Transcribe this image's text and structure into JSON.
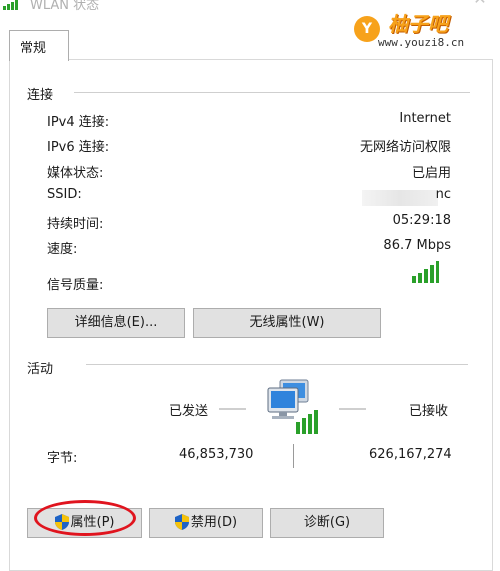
{
  "window": {
    "title": "WLAN 状态"
  },
  "watermark": {
    "logo_letter": "Y",
    "title": "柚子吧",
    "url": "www.youzi8.cn"
  },
  "tabs": [
    {
      "label": "常规"
    }
  ],
  "connection": {
    "title": "连接",
    "rows": [
      {
        "label": "IPv4 连接:",
        "value": "Internet"
      },
      {
        "label": "IPv6 连接:",
        "value": "无网络访问权限"
      },
      {
        "label": "媒体状态:",
        "value": "已启用"
      },
      {
        "label": "SSID:",
        "value": "nc"
      },
      {
        "label": "持续时间:",
        "value": "05:29:18"
      },
      {
        "label": "速度:",
        "value": "86.7 Mbps"
      },
      {
        "label": "信号质量:",
        "value": ""
      }
    ],
    "signal_bars": 5,
    "buttons": {
      "details": "详细信息(E)...",
      "wireless_properties": "无线属性(W)"
    }
  },
  "activity": {
    "title": "活动",
    "sent_label": "已发送",
    "received_label": "已接收",
    "bytes_label": "字节:",
    "bytes_sent": "46,853,730",
    "bytes_received": "626,167,274"
  },
  "actions": {
    "properties": "属性(P)",
    "disable": "禁用(D)",
    "diagnose": "诊断(G)"
  },
  "colors": {
    "accent": "#f7a21b",
    "highlight": "#e0141e",
    "signal": "#2aa02a"
  }
}
